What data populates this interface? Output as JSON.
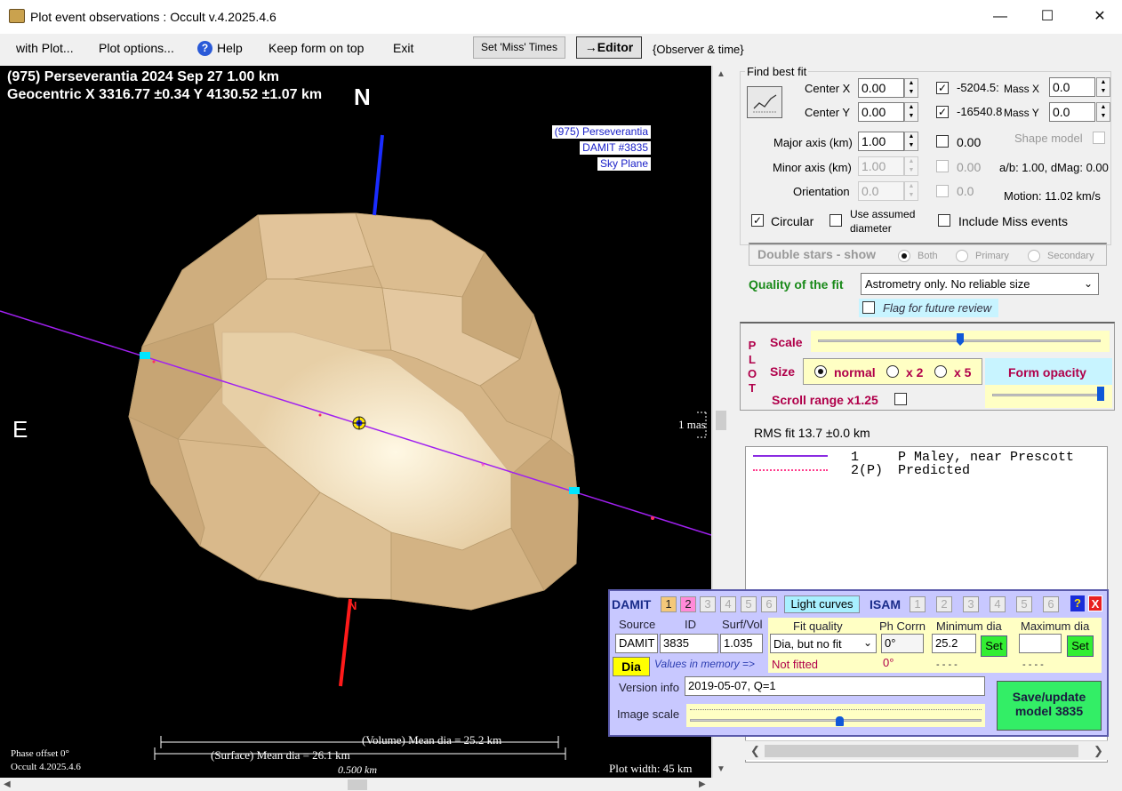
{
  "window": {
    "title": "Plot event observations : Occult v.4.2025.4.6",
    "controls": {
      "minimize": "—",
      "maximize": "☐",
      "close": "✕"
    }
  },
  "menu": {
    "with_plot": "with Plot...",
    "plot_options": "Plot options...",
    "help": "Help",
    "keep_on_top": "Keep form on top",
    "exit": "Exit",
    "set_miss_times": "Set 'Miss' Times",
    "editor": "→Editor",
    "observer_time": "{Observer & time}"
  },
  "plot": {
    "header_line1": "(975) Perseverantia  2024 Sep 27   1.00 km",
    "header_line2": "Geocentric  X  3316.77 ±0.34  Y 4130.52 ±1.07 km",
    "north_label": "N",
    "east_label": "E",
    "south_n_label": "N",
    "sky_labels": [
      "(975) Perseverantia",
      "DAMIT #3835",
      "Sky Plane"
    ],
    "mas_label": "1 mas",
    "volume_mean": "(Volume) Mean dia = 25.2 km",
    "surface_mean": "(Surface) Mean dia = 26.1 km",
    "scale_label": "0.500 km",
    "phase_offset": "Phase offset 0°",
    "occult_version": "Occult 4.2025.4.6",
    "plot_width": "Plot width: 45 km"
  },
  "fit": {
    "group_label": "Find best fit",
    "center_x_label": "Center X",
    "center_x": "0.00",
    "center_y_label": "Center Y",
    "center_y": "0.00",
    "offset_x": "-5204.5:",
    "offset_y": "-16540.8",
    "mass_x_label": "Mass X",
    "mass_x": "0.0",
    "mass_y_label": "Mass Y",
    "mass_y": "0.0",
    "major_label": "Major axis (km)",
    "major": "1.00",
    "major_chk_val": "0.00",
    "minor_label": "Minor axis (km)",
    "minor": "1.00",
    "minor_chk_val": "0.00",
    "orient_label": "Orientation",
    "orient": "0.0",
    "orient_chk_val": "0.0",
    "shape_model_label": "Shape model",
    "ab_dmag": "a/b: 1.00, dMag: 0.00",
    "motion": "Motion: 11.02 km/s",
    "circular_label": "Circular",
    "use_assumed_label_1": "Use assumed",
    "use_assumed_label_2": "diameter",
    "include_miss_label": "Include Miss events",
    "double_stars_label": "Double stars - show",
    "both_label": "Both",
    "primary_label": "Primary",
    "secondary_label": "Secondary",
    "quality_label": "Quality of the fit",
    "quality_value": "Astrometry only. No reliable size",
    "flag_review_label": "Flag for future review"
  },
  "plotpanel": {
    "plot_letters": [
      "P",
      "L",
      "O",
      "T"
    ],
    "scale_label": "Scale",
    "size_label": "Size",
    "normal_label": "normal",
    "x2_label": "x 2",
    "x5_label": "x 5",
    "form_opacity_label": "Form opacity",
    "scroll_range_label": "Scroll range x1.25"
  },
  "rms": "RMS fit 13.7 ±0.0 km",
  "legend": [
    {
      "num": "1",
      "name": "P Maley, near Prescott",
      "style": "solid",
      "color": "#8a2be2"
    },
    {
      "num": "2(P)",
      "name": "Predicted",
      "style": "dotted",
      "color": "#ff3c8c"
    }
  ],
  "damit": {
    "damit_label": "DAMIT",
    "damit_nums": [
      "1",
      "2",
      "3",
      "4",
      "5",
      "6"
    ],
    "light_curves_label": "Light curves",
    "isam_label": "ISAM",
    "isam_nums": [
      "1",
      "2",
      "3",
      "4",
      "5",
      "6"
    ],
    "help_label": "?",
    "close_label": "X",
    "source_head": "Source",
    "id_head": "ID",
    "surfvol_head": "Surf/Vol",
    "fitq_head": "Fit quality",
    "phcorr_head": "Ph Corrn",
    "mindia_head": "Minimum dia",
    "maxdia_head": "Maximum dia",
    "source": "DAMIT",
    "id": "3835",
    "surfvol": "1.035",
    "fitq": "Dia, but no fit",
    "phcorr": "0°",
    "mindia": "25.2",
    "maxdia": "",
    "set_label": "Set",
    "dia_label": "Dia",
    "values_mem": "Values in memory =>",
    "not_fitted": "Not fitted",
    "ph_mem": "0°",
    "min_mem": "- - - -",
    "max_mem": "- - - -",
    "version_label": "Version info",
    "version": "2019-05-07, Q=1",
    "image_scale_label": "Image scale",
    "save_label_1": "Save/update",
    "save_label_2": "model 3835"
  },
  "colors": {
    "asteroid_base": "#d8b98c",
    "north_axis": "#1a2cff",
    "south_axis": "#ff1a1a",
    "chord": "#8a2be2",
    "quality_green": "#1a8a1a",
    "plot_maroon": "#b0004a"
  }
}
